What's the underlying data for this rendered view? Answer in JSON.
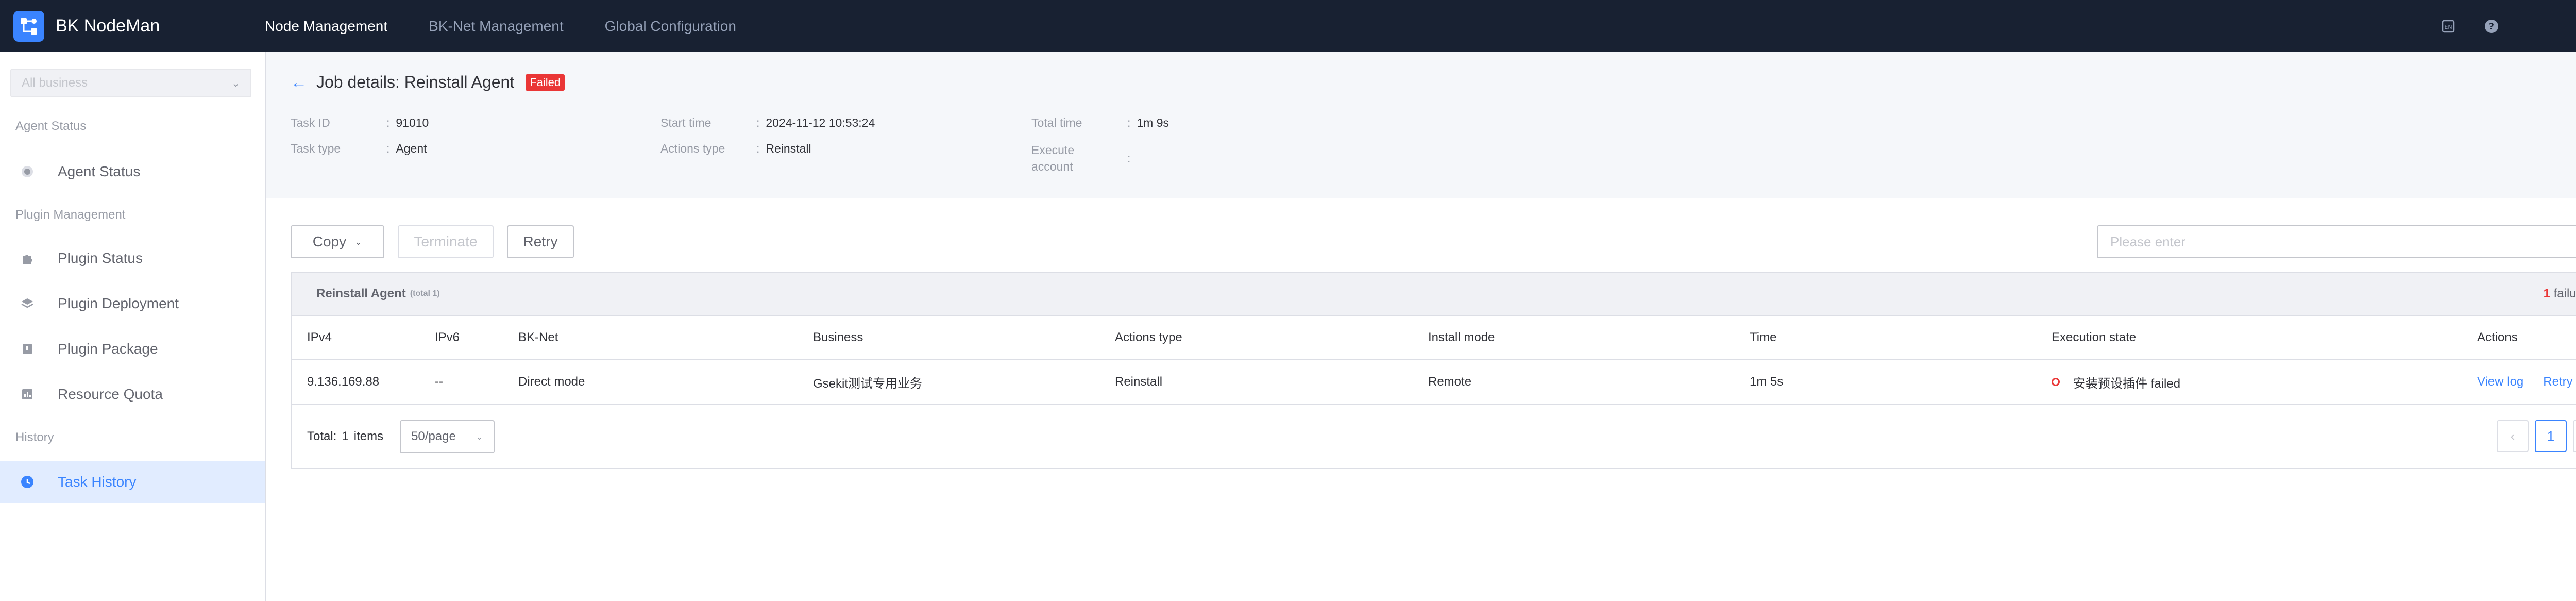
{
  "app": {
    "name": "BK NodeMan"
  },
  "nav": {
    "items": [
      "Node Management",
      "BK-Net Management",
      "Global Configuration"
    ]
  },
  "sidebar": {
    "business_select": "All business",
    "groups": {
      "agent": "Agent Status",
      "plugin": "Plugin Management",
      "history": "History"
    },
    "items": [
      "Agent Status",
      "Plugin Status",
      "Plugin Deployment",
      "Plugin Package",
      "Resource Quota",
      "Task History"
    ]
  },
  "job": {
    "title": "Job details: Reinstall Agent",
    "badge": "Failed",
    "fields": {
      "task_id_label": "Task ID",
      "task_id": "91010",
      "task_type_label": "Task type",
      "task_type": "Agent",
      "start_label": "Start time",
      "start": "2024-11-12 10:53:24",
      "actions_label": "Actions type",
      "actions": "Reinstall",
      "total_label": "Total time",
      "total": "1m 9s",
      "exec_label_1": "Execute",
      "exec_label_2": "account",
      "exec_account": ""
    }
  },
  "toolbar": {
    "copy": "Copy",
    "terminate": "Terminate",
    "retry": "Retry",
    "search_placeholder": "Please enter"
  },
  "table": {
    "group_name": "Reinstall Agent",
    "group_total": "(total 1)",
    "failure_count": "1",
    "failure_label": "failure",
    "columns": [
      "IPv4",
      "IPv6",
      "BK-Net",
      "Business",
      "Actions type",
      "Install mode",
      "Time",
      "Execution state",
      "Actions"
    ],
    "rows": [
      {
        "ipv4": "9.136.169.88",
        "ipv6": "--",
        "bknet": "Direct mode",
        "business": "Gsekit测试专用业务",
        "actions_type": "Reinstall",
        "install_mode": "Remote",
        "time": "1m 5s",
        "state": "安装预设插件 failed",
        "view_log": "View log",
        "retry": "Retry"
      }
    ]
  },
  "pagination": {
    "total_label": "Total:",
    "total": "1",
    "items_label": "items",
    "page_size": "50/page",
    "current": "1"
  },
  "colors": {
    "primary": "#3a84ff",
    "danger": "#ea3636",
    "topbar": "#182132"
  }
}
